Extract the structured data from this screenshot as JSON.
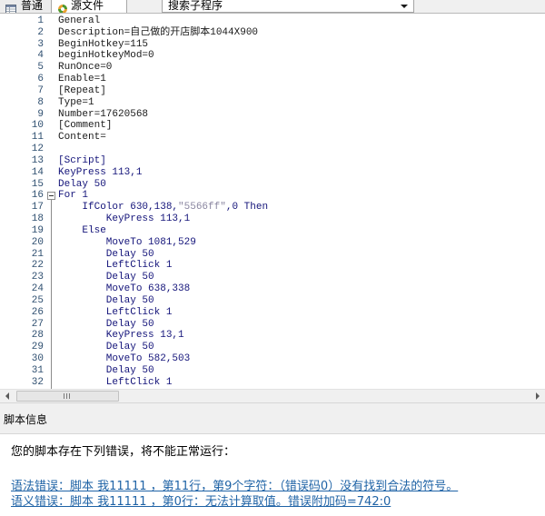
{
  "tab_bar": {
    "tabs": [
      {
        "label": "普通",
        "icon": "table-icon",
        "active": false
      },
      {
        "label": "源文件",
        "icon": "source-code-icon",
        "active": true
      }
    ],
    "subroutine_dropdown": {
      "value": "搜索子程序",
      "icon": "chevron-down-icon"
    }
  },
  "editor": {
    "fold_icon": "collapse-minus-icon",
    "lines": [
      {
        "num": "1",
        "kind": "meta",
        "segs": [
          {
            "text": "General"
          }
        ]
      },
      {
        "num": "2",
        "kind": "meta",
        "segs": [
          {
            "text": "Description=自己做的开店脚本1044X900"
          }
        ]
      },
      {
        "num": "3",
        "kind": "meta",
        "segs": [
          {
            "text": "BeginHotkey=115"
          }
        ]
      },
      {
        "num": "4",
        "kind": "meta",
        "segs": [
          {
            "text": "beginHotkeyMod=0"
          }
        ]
      },
      {
        "num": "5",
        "kind": "meta",
        "segs": [
          {
            "text": "RunOnce=0"
          }
        ]
      },
      {
        "num": "6",
        "kind": "meta",
        "segs": [
          {
            "text": "Enable=1"
          }
        ]
      },
      {
        "num": "7",
        "kind": "meta",
        "segs": [
          {
            "text": "[Repeat]"
          }
        ]
      },
      {
        "num": "8",
        "kind": "meta",
        "segs": [
          {
            "text": "Type=1"
          }
        ]
      },
      {
        "num": "9",
        "kind": "meta",
        "segs": [
          {
            "text": "Number=17620568"
          }
        ]
      },
      {
        "num": "10",
        "kind": "meta",
        "segs": [
          {
            "text": "[Comment]"
          }
        ]
      },
      {
        "num": "11",
        "kind": "meta",
        "segs": [
          {
            "text": "Content="
          }
        ]
      },
      {
        "num": "12",
        "kind": "meta",
        "segs": []
      },
      {
        "num": "13",
        "kind": "script",
        "segs": [
          {
            "text": "[Script]"
          }
        ]
      },
      {
        "num": "14",
        "kind": "script",
        "segs": [
          {
            "text": "KeyPress 113,1"
          }
        ]
      },
      {
        "num": "15",
        "kind": "script",
        "segs": [
          {
            "text": "Delay 50"
          }
        ]
      },
      {
        "num": "16",
        "kind": "script",
        "fold": "expanded",
        "segs": [
          {
            "text": "For 1"
          }
        ]
      },
      {
        "num": "17",
        "kind": "script",
        "segs": [
          {
            "text": "    IfColor 630,138,"
          },
          {
            "text": "\"5566ff\"",
            "style": "string"
          },
          {
            "text": ",0 Then"
          }
        ]
      },
      {
        "num": "18",
        "kind": "script",
        "segs": [
          {
            "text": "        KeyPress 113,1"
          }
        ]
      },
      {
        "num": "19",
        "kind": "script",
        "segs": [
          {
            "text": "    Else"
          }
        ]
      },
      {
        "num": "20",
        "kind": "script",
        "segs": [
          {
            "text": "        MoveTo 1081,529"
          }
        ]
      },
      {
        "num": "21",
        "kind": "script",
        "segs": [
          {
            "text": "        Delay 50"
          }
        ]
      },
      {
        "num": "22",
        "kind": "script",
        "segs": [
          {
            "text": "        LeftClick 1"
          }
        ]
      },
      {
        "num": "23",
        "kind": "script",
        "segs": [
          {
            "text": "        Delay 50"
          }
        ]
      },
      {
        "num": "24",
        "kind": "script",
        "segs": [
          {
            "text": "        MoveTo 638,338"
          }
        ]
      },
      {
        "num": "25",
        "kind": "script",
        "segs": [
          {
            "text": "        Delay 50"
          }
        ]
      },
      {
        "num": "26",
        "kind": "script",
        "segs": [
          {
            "text": "        LeftClick 1"
          }
        ]
      },
      {
        "num": "27",
        "kind": "script",
        "segs": [
          {
            "text": "        Delay 50"
          }
        ]
      },
      {
        "num": "28",
        "kind": "script",
        "segs": [
          {
            "text": "        KeyPress 13,1"
          }
        ]
      },
      {
        "num": "29",
        "kind": "script",
        "segs": [
          {
            "text": "        Delay 50"
          }
        ]
      },
      {
        "num": "30",
        "kind": "script",
        "segs": [
          {
            "text": "        MoveTo 582,503"
          }
        ]
      },
      {
        "num": "31",
        "kind": "script",
        "segs": [
          {
            "text": "        Delay 50"
          }
        ]
      },
      {
        "num": "32",
        "kind": "script",
        "segs": [
          {
            "text": "        LeftClick 1"
          }
        ]
      }
    ],
    "horizontal_scrollbar": {
      "position": 0,
      "visible_fraction": 0.2,
      "left_icon": "scroll-left-arrow-icon",
      "right_icon": "scroll-right-arrow-icon",
      "grip_icon": "scroll-thumb-grip-icon"
    }
  },
  "info_panel": {
    "title": "脚本信息",
    "message": "您的脚本存在下列错误，将不能正常运行：",
    "errors": [
      "语法错误：脚本 我11111 ，第11行，第9个字符：（错误码0）没有找到合法的符号。",
      "语义错误：脚本 我11111 ，第0行：无法计算取值。错误附加码=742:0"
    ]
  },
  "colors": {
    "meta_text": "#1a1a1a",
    "script_text": "#14147a",
    "string_literal": "#8a86a0",
    "line_number": "#2f4f70",
    "error_link": "#1f63a6"
  }
}
